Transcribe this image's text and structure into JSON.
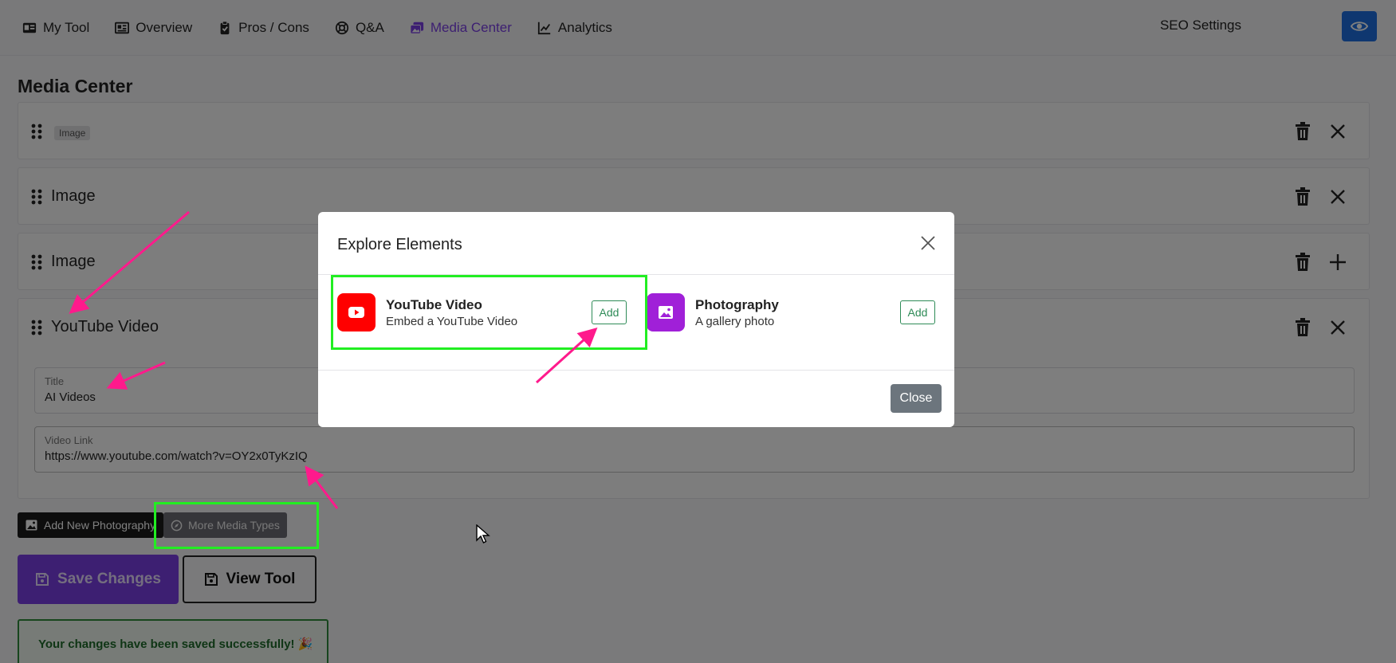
{
  "nav": {
    "items": [
      {
        "label": "My Tool",
        "icon": "id-card-icon"
      },
      {
        "label": "Overview",
        "icon": "newspaper-icon"
      },
      {
        "label": "Pros / Cons",
        "icon": "clipboard-check-icon"
      },
      {
        "label": "Q&A",
        "icon": "lifebuoy-icon"
      },
      {
        "label": "Media Center",
        "icon": "photos-icon",
        "active": true
      },
      {
        "label": "Analytics",
        "icon": "chart-line-icon"
      }
    ],
    "seo_label": "SEO Settings",
    "accent": "#7b3fe4",
    "preview_button_color": "#1f6fe0"
  },
  "page": {
    "title": "Media Center"
  },
  "media_items": [
    {
      "label": "Image",
      "style": "badge",
      "action_icon": "close-icon"
    },
    {
      "label": "Image",
      "action_icon": "close-icon"
    },
    {
      "label": "Image",
      "action_icon": "plus-icon"
    },
    {
      "label": "YouTube Video",
      "action_icon": "close-icon",
      "fields": [
        {
          "label": "Title",
          "value": "AI Videos"
        },
        {
          "label": "Video Link",
          "value": "https://www.youtube.com/watch?v=OY2x0TyKzIQ"
        }
      ]
    }
  ],
  "actions": {
    "add_photography": "Add New Photography",
    "more_media_types": "More Media Types",
    "save": "Save Changes",
    "view_tool": "View Tool",
    "success_message": "Your changes have been saved successfully! 🎉"
  },
  "modal": {
    "title": "Explore Elements",
    "elements": [
      {
        "name": "YouTube Video",
        "description": "Embed a YouTube Video",
        "add_label": "Add",
        "icon": "youtube-icon",
        "color": "#ff0000"
      },
      {
        "name": "Photography",
        "description": "A gallery photo",
        "add_label": "Add",
        "icon": "image-icon",
        "color": "#a020d8"
      }
    ],
    "close_label": "Close"
  },
  "annotations": {
    "highlight_color": "#22ee22",
    "arrow_color": "#ff1a8c"
  }
}
